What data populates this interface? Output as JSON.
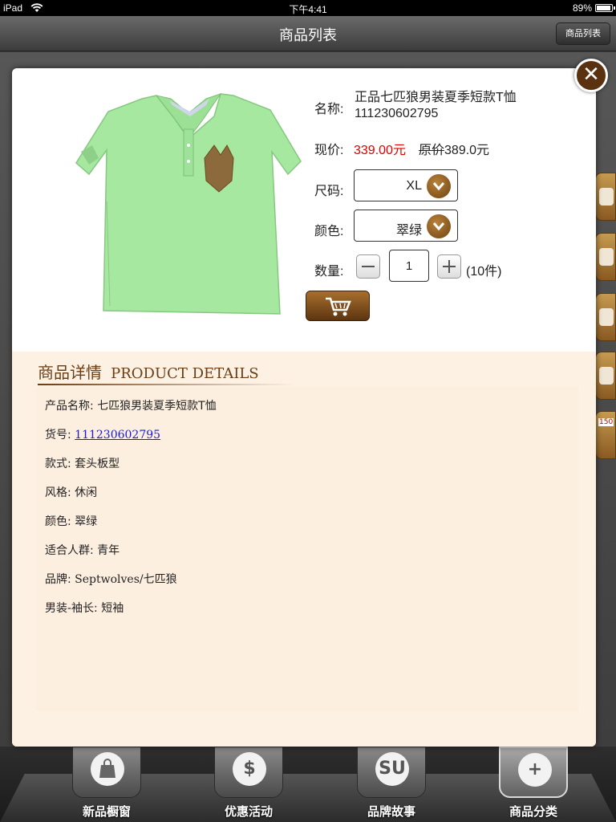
{
  "status_bar": {
    "carrier": "iPad",
    "time": "下午4:41",
    "battery": "89%"
  },
  "nav": {
    "title": "商品列表",
    "right_button": "商品列表"
  },
  "side_icons": [
    {
      "name": "edit-icon"
    },
    {
      "name": "bag-icon"
    },
    {
      "name": "star-icon"
    },
    {
      "name": "share-icon"
    },
    {
      "name": "price-tag-icon",
      "tag": "150"
    }
  ],
  "product": {
    "name_label": "名称:",
    "name": "正品七匹狼男装夏季短款T恤 111230602795",
    "price_label": "现价:",
    "price_current": "339.00元",
    "price_original_prefix": "原价",
    "price_original_value": "389.0元",
    "size_label": "尺码:",
    "size_value": "XL",
    "color_label": "颜色:",
    "color_value": "翠绿",
    "qty_label": "数量:",
    "qty_value": "1",
    "qty_stock": "(10件)",
    "image_icon": "polo-shirt-image"
  },
  "details": {
    "title_cn": "商品详情",
    "title_en": "PRODUCT DETAILS",
    "items": [
      {
        "label": "产品名称: ",
        "value": "七匹狼男装夏季短款T恤"
      },
      {
        "label": "货号: ",
        "value": "111230602795"
      },
      {
        "label": "款式: ",
        "value": "套头板型"
      },
      {
        "label": "风格: ",
        "value": "休闲"
      },
      {
        "label": "颜色: ",
        "value": "翠绿"
      },
      {
        "label": "适合人群: ",
        "value": "青年"
      },
      {
        "label": "品牌: ",
        "value": "Septwolves/七匹狼"
      },
      {
        "label": "男装-袖长: ",
        "value": "短袖"
      }
    ]
  },
  "tabs": [
    {
      "label": "新品橱窗",
      "icon": "shopping-bag-icon",
      "mark": "",
      "active": false
    },
    {
      "label": "优惠活动",
      "icon": "price-tag-icon",
      "mark": "$",
      "active": false
    },
    {
      "label": "品牌故事",
      "icon": "stumbleupon-icon",
      "mark": "SU",
      "active": false
    },
    {
      "label": "商品分类",
      "icon": "signpost-icon",
      "mark": "+",
      "active": true
    }
  ],
  "colors": {
    "accent_brown": "#6a3d14",
    "price_red": "#e00000",
    "details_bg": "#fdf1e3",
    "shirt_green": "#a6e8a0"
  }
}
